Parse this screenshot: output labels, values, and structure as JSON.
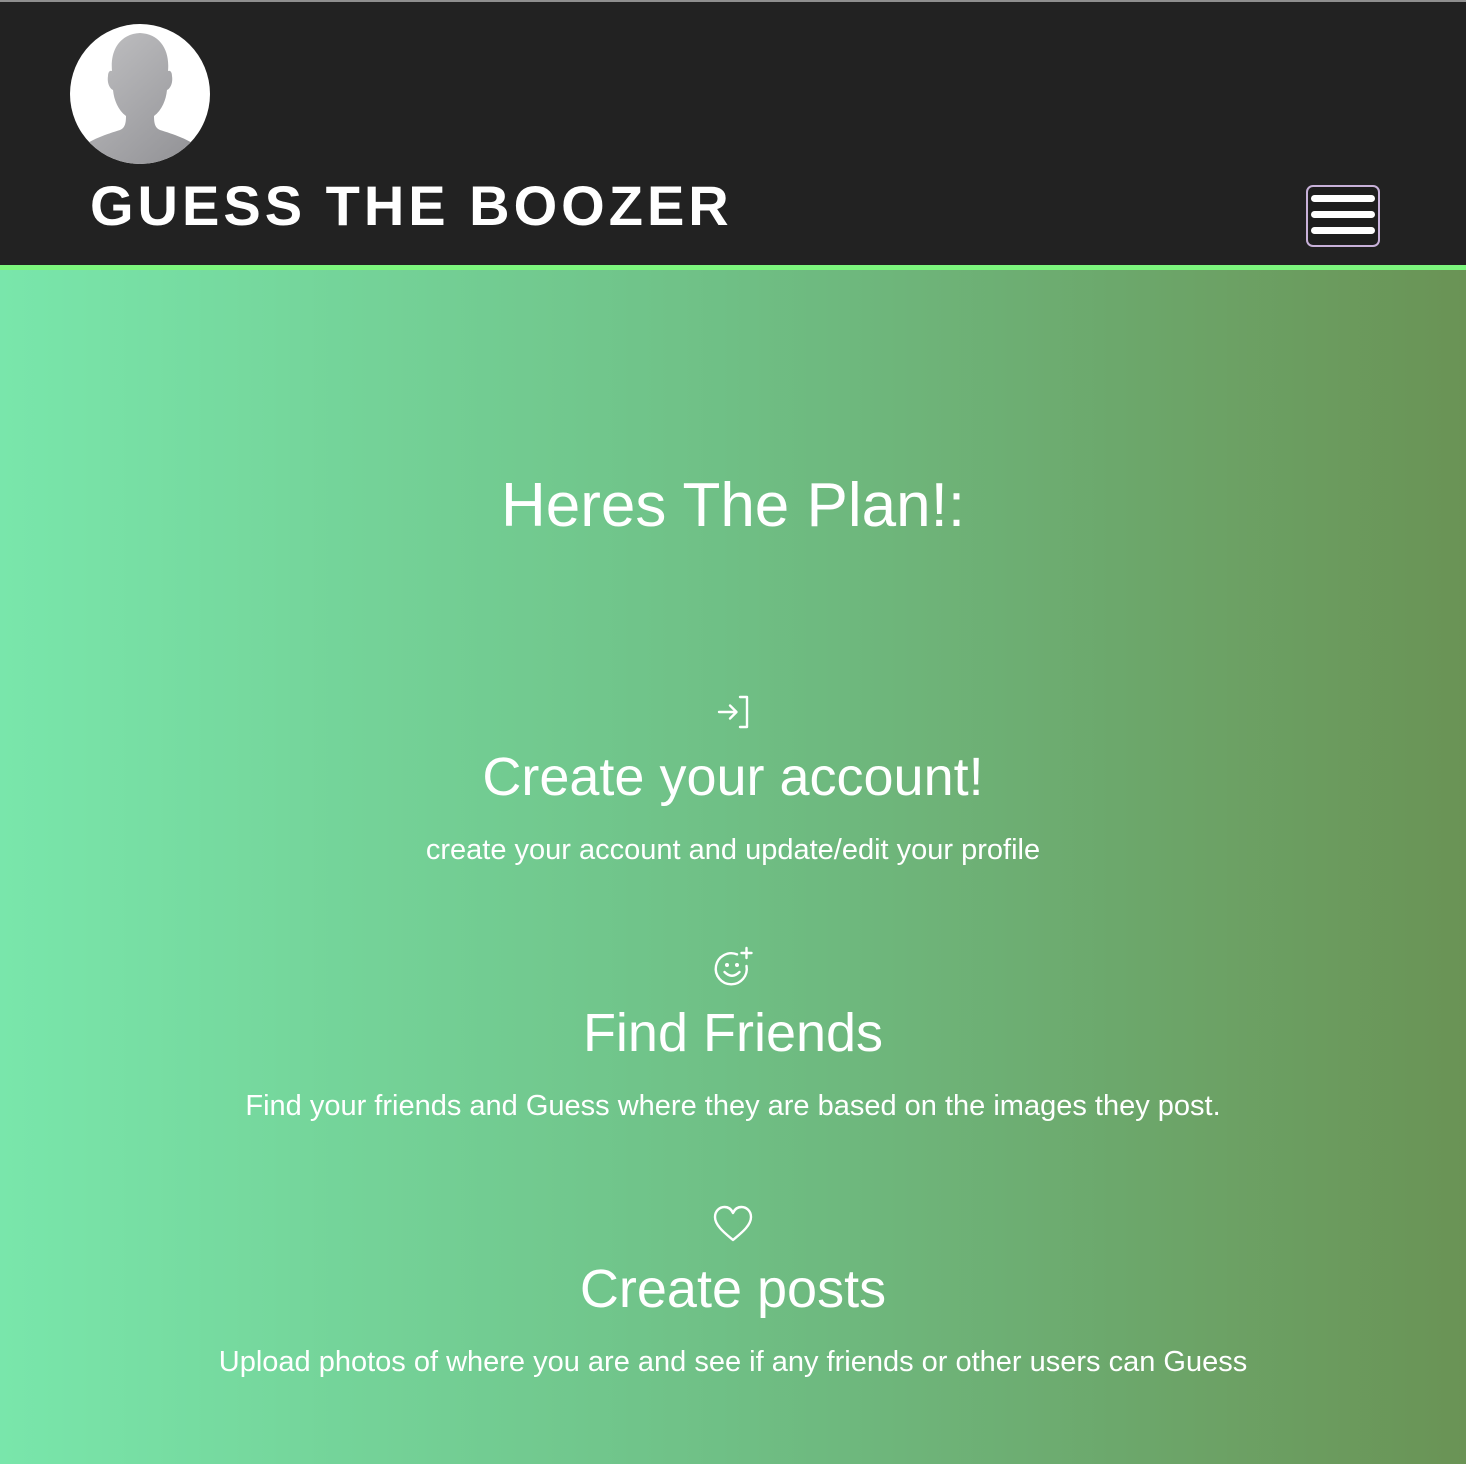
{
  "navbar": {
    "brand": "GUESS THE BOOZER",
    "avatar_icon": "default-user-silhouette-icon",
    "menu_icon": "hamburger-icon",
    "background": "#222222",
    "accent_border": "#7cf57d"
  },
  "main": {
    "title": "Heres The Plan!:",
    "gradient": [
      "#79e6ab",
      "#6a9355"
    ],
    "steps": [
      {
        "icon": "sign-in-icon",
        "heading": "Create your account!",
        "description": "create your account and update/edit your profile"
      },
      {
        "icon": "emoji-add-icon",
        "heading": "Find Friends",
        "description": "Find your friends and Guess where they are based on the images they post."
      },
      {
        "icon": "heart-icon",
        "heading": "Create posts",
        "description": "Upload photos of where you are and see if any friends or other users can Guess"
      }
    ]
  }
}
